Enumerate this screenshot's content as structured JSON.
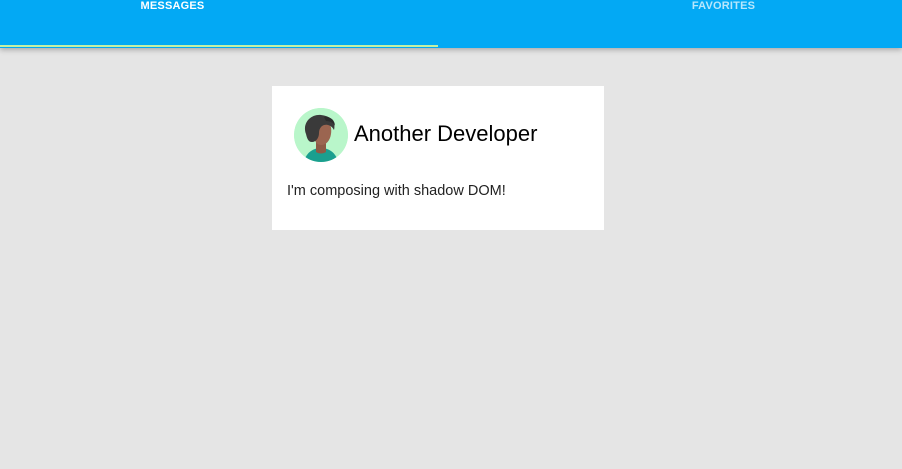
{
  "toolbar": {
    "accent_color": "#03a9f4",
    "indicator_color": "#c5f0a4"
  },
  "tabs": [
    {
      "label": "MESSAGES",
      "selected": true
    },
    {
      "label": "FAVORITES",
      "selected": false
    }
  ],
  "card": {
    "author": "Another Developer",
    "avatar_icon": "person-avatar-icon",
    "message": "I'm composing with shadow DOM!"
  }
}
